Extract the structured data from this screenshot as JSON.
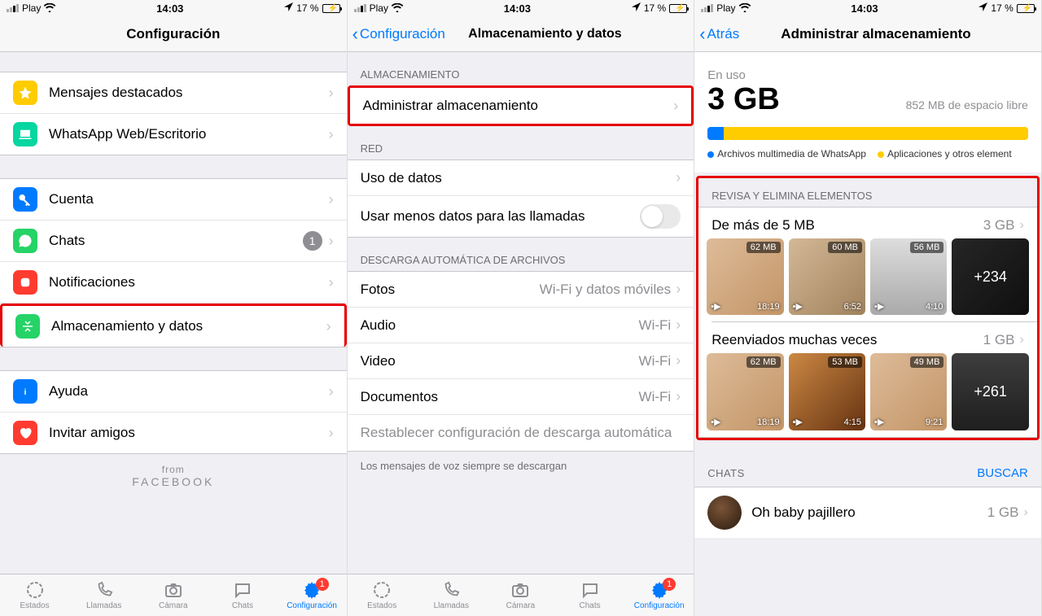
{
  "status": {
    "carrier": "Play",
    "time": "14:03",
    "battery_pct": "17 %"
  },
  "screen1": {
    "title": "Configuración",
    "rows": {
      "starred": "Mensajes destacados",
      "web": "WhatsApp Web/Escritorio",
      "account": "Cuenta",
      "chats": "Chats",
      "chats_badge": "1",
      "notifications": "Notificaciones",
      "storage": "Almacenamiento y datos",
      "help": "Ayuda",
      "invite": "Invitar amigos"
    },
    "from": "from",
    "facebook": "FACEBOOK"
  },
  "screen2": {
    "back": "Configuración",
    "title": "Almacenamiento y datos",
    "sec_storage": "ALMACENAMIENTO",
    "manage": "Administrar almacenamiento",
    "sec_network": "RED",
    "data_usage": "Uso de datos",
    "low_data": "Usar menos datos para las llamadas",
    "sec_dl": "DESCARGA AUTOMÁTICA DE ARCHIVOS",
    "photos": "Fotos",
    "photos_v": "Wi-Fi y datos móviles",
    "audio": "Audio",
    "audio_v": "Wi-Fi",
    "video": "Video",
    "video_v": "Wi-Fi",
    "docs": "Documentos",
    "docs_v": "Wi-Fi",
    "reset": "Restablecer configuración de descarga automática",
    "voice_note": "Los mensajes de voz siempre se descargan"
  },
  "screen3": {
    "back": "Atrás",
    "title": "Administrar almacenamiento",
    "in_use": "En uso",
    "used": "3 GB",
    "free": "852 MB de espacio libre",
    "legend1": "Archivos multimedia de WhatsApp",
    "legend2": "Aplicaciones y otros element",
    "review": "REVISA Y ELIMINA ELEMENTOS",
    "larger": "De más de 5 MB",
    "larger_amt": "3 GB",
    "larger_thumbs": [
      {
        "size": "62 MB",
        "dur": "18:19"
      },
      {
        "size": "60 MB",
        "dur": "6:52"
      },
      {
        "size": "56 MB",
        "dur": "4:10"
      },
      {
        "more": "+234"
      }
    ],
    "forwarded": "Reenviados muchas veces",
    "forwarded_amt": "1 GB",
    "forwarded_thumbs": [
      {
        "size": "62 MB",
        "dur": "18:19"
      },
      {
        "size": "53 MB",
        "dur": "4:15"
      },
      {
        "size": "49 MB",
        "dur": "9:21"
      },
      {
        "more": "+261"
      }
    ],
    "chats_header": "CHATS",
    "search": "BUSCAR",
    "chat1_name": "Oh baby pajillero",
    "chat1_amt": "1 GB"
  },
  "tabs": {
    "status": "Estados",
    "calls": "Llamadas",
    "camera": "Cámara",
    "chats": "Chats",
    "settings": "Configuración",
    "badge": "1"
  }
}
